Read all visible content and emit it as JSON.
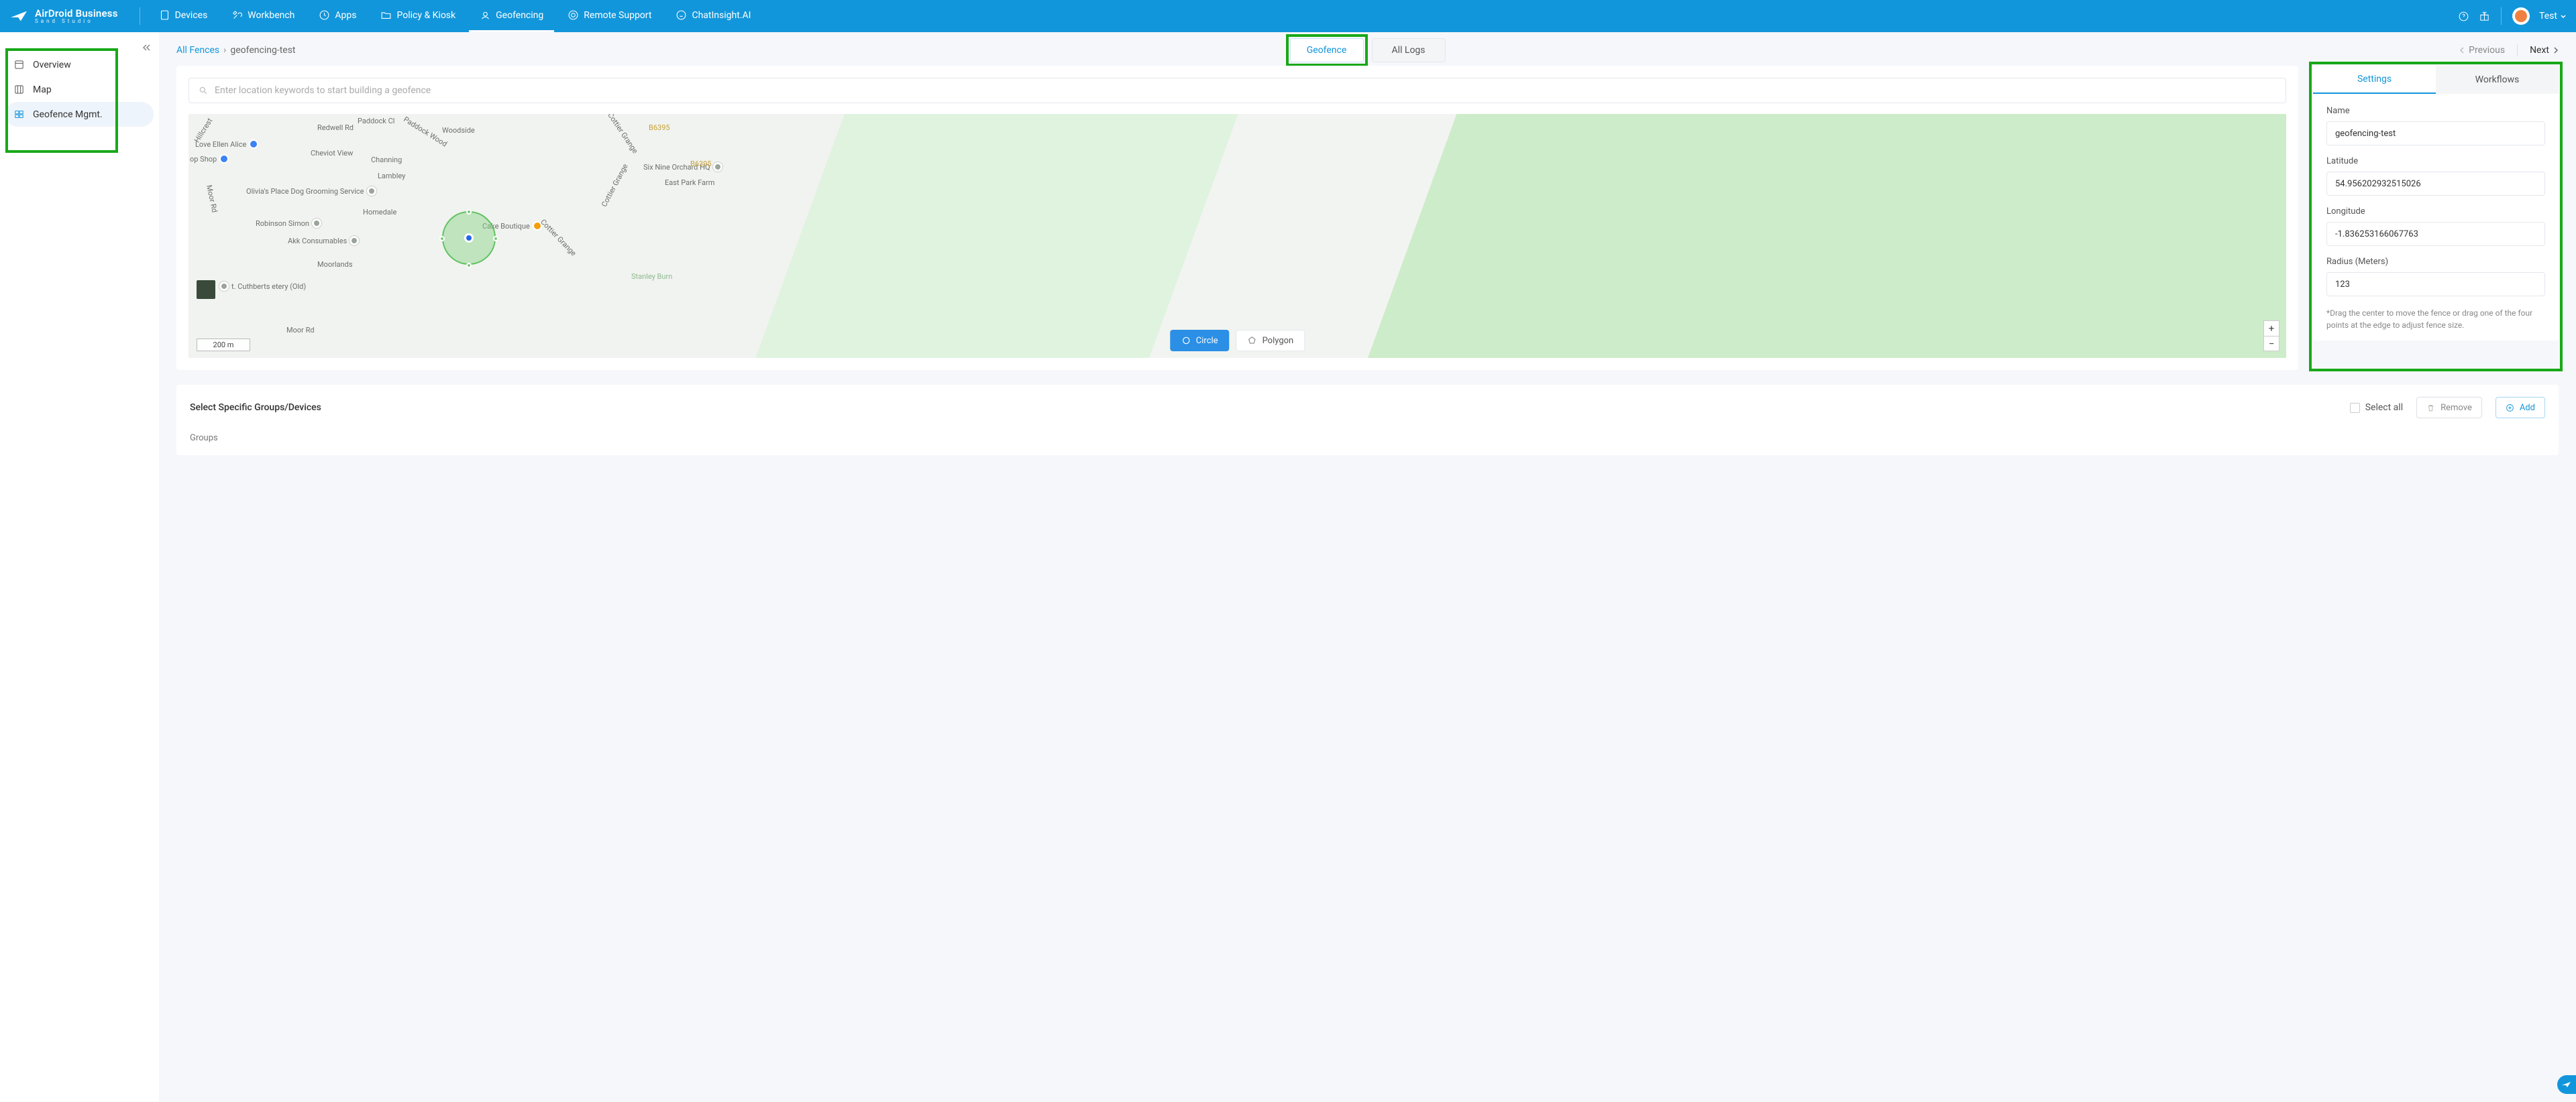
{
  "brand": {
    "name": "AirDroid Business",
    "subtitle": "Sand Studio"
  },
  "nav": {
    "items": [
      {
        "label": "Devices"
      },
      {
        "label": "Workbench"
      },
      {
        "label": "Apps"
      },
      {
        "label": "Policy & Kiosk"
      },
      {
        "label": "Geofencing",
        "active": true
      },
      {
        "label": "Remote Support"
      },
      {
        "label": "ChatInsight.AI"
      }
    ],
    "user": "Test"
  },
  "sidebar": {
    "items": [
      {
        "label": "Overview"
      },
      {
        "label": "Map"
      },
      {
        "label": "Geofence Mgmt.",
        "active": true
      }
    ]
  },
  "breadcrumb": {
    "root": "All Fences",
    "current": "geofencing-test"
  },
  "center_tabs": {
    "geofence": "Geofence",
    "all_logs": "All Logs"
  },
  "pager": {
    "prev": "Previous",
    "next": "Next"
  },
  "search_placeholder": "Enter location keywords to start building a geofence",
  "map": {
    "scale": "200 m",
    "circle_btn": "Circle",
    "polygon_btn": "Polygon",
    "pois": {
      "love_ellen": "Love Ellen Alice",
      "op_shop": "op Shop",
      "olivia": "Olivia's Place Dog Grooming Service",
      "robinson": "Robinson Simon",
      "akk": "Akk Consumables",
      "cuthberts": "t. Cuthberts etery (Old)",
      "cake": "Cake Boutique",
      "orchard": "Six Nine Orchard HQ",
      "east_park": "East Park Farm",
      "b6395a": "B6395",
      "b6395b": "B6395"
    },
    "roads": {
      "redwell": "Redwell Rd",
      "paddock": "Paddock Cl",
      "paddock_wood": "Paddock Wood",
      "woodside": "Woodside",
      "cheviot": "Cheviot View",
      "channing": "Channing",
      "lambley": "Lambley",
      "homedale": "Homedale",
      "moorlands": "Moorlands",
      "moor_rd": "Moor Rd",
      "cottier1": "Cottier Grange",
      "cottier2": "Cottier Grange",
      "cottier3": "Cottier Grange",
      "hillcrest": "Hillcrest",
      "stanley": "Stanley Burn"
    }
  },
  "settings": {
    "tab_settings": "Settings",
    "tab_workflows": "Workflows",
    "name_label": "Name",
    "name_value": "geofencing-test",
    "lat_label": "Latitude",
    "lat_value": "54.956202932515026",
    "lon_label": "Longitude",
    "lon_value": "-1.836253166067763",
    "radius_label": "Radius (Meters)",
    "radius_value": "123",
    "hint": "*Drag the center to move the fence or drag one of the four points at the edge to adjust fence size."
  },
  "devices": {
    "title": "Select Specific Groups/Devices",
    "select_all": "Select all",
    "remove": "Remove",
    "add": "Add",
    "groups": "Groups"
  }
}
